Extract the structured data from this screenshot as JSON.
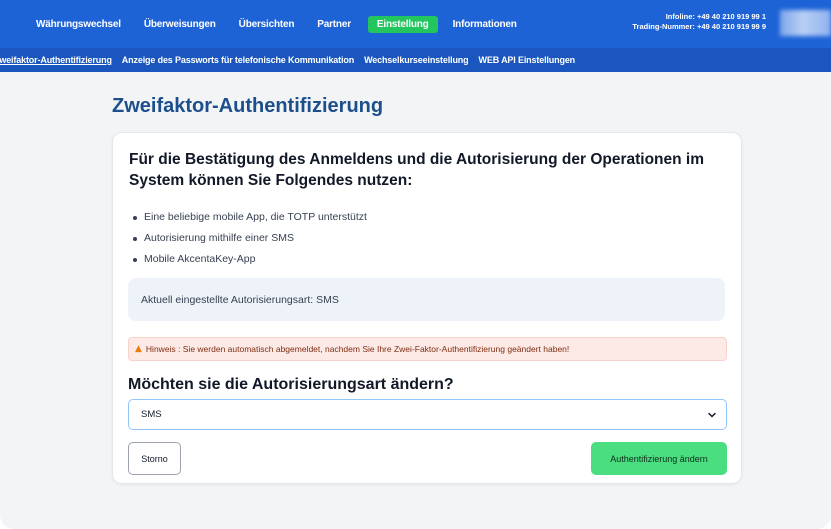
{
  "topbar": {
    "left_glyph": ")",
    "nav": [
      {
        "label": "Währungswechsel",
        "active": false
      },
      {
        "label": "Überweisungen",
        "active": false
      },
      {
        "label": "Übersichten",
        "active": false
      },
      {
        "label": "Partner",
        "active": false
      },
      {
        "label": "Einstellung",
        "active": true
      },
      {
        "label": "Informationen",
        "active": false
      }
    ],
    "infoline": "Infoline: +49 40 210 919 99 1",
    "trading_number": "Trading-Nummer: +49 40 210 919 99 9"
  },
  "subnav": [
    {
      "label": "Zweifaktor-Authentifizierung",
      "active": true
    },
    {
      "label": "Anzeige des Passworts für telefonische Kommunikation",
      "active": false
    },
    {
      "label": "Wechselkurseeinstellung",
      "active": false
    },
    {
      "label": "WEB API Einstellungen",
      "active": false
    }
  ],
  "page": {
    "title": "Zweifaktor-Authentifizierung",
    "intro": "Für die Bestätigung des Anmeldens und die Autorisierung der Operationen im System können Sie Folgendes nutzen:",
    "bullets": [
      "Eine beliebige mobile App, die TOTP unterstützt",
      "Autorisierung mithilfe einer SMS",
      "Mobile AkcentaKey-App"
    ],
    "current_method": "Aktuell eingestellte Autorisierungsart: SMS",
    "notice": "Hinweis : Sie werden automatisch abgemeldet, nachdem Sie Ihre Zwei-Faktor-Authentifizierung geändert haben!",
    "change_question": "Möchten sie die Autorisierungsart ändern?",
    "select_value": "SMS",
    "cancel_label": "Storno",
    "change_label": "Authentifizierung ändern"
  },
  "colors": {
    "topbar": "#1e63d6",
    "subnav": "#1a56bd",
    "accent_green": "#22c55e",
    "button_green": "#4ade80",
    "title_blue": "#1d4f8c"
  },
  "icons": {
    "notice": "warning-triangle-icon",
    "select": "chevron-down-icon"
  }
}
